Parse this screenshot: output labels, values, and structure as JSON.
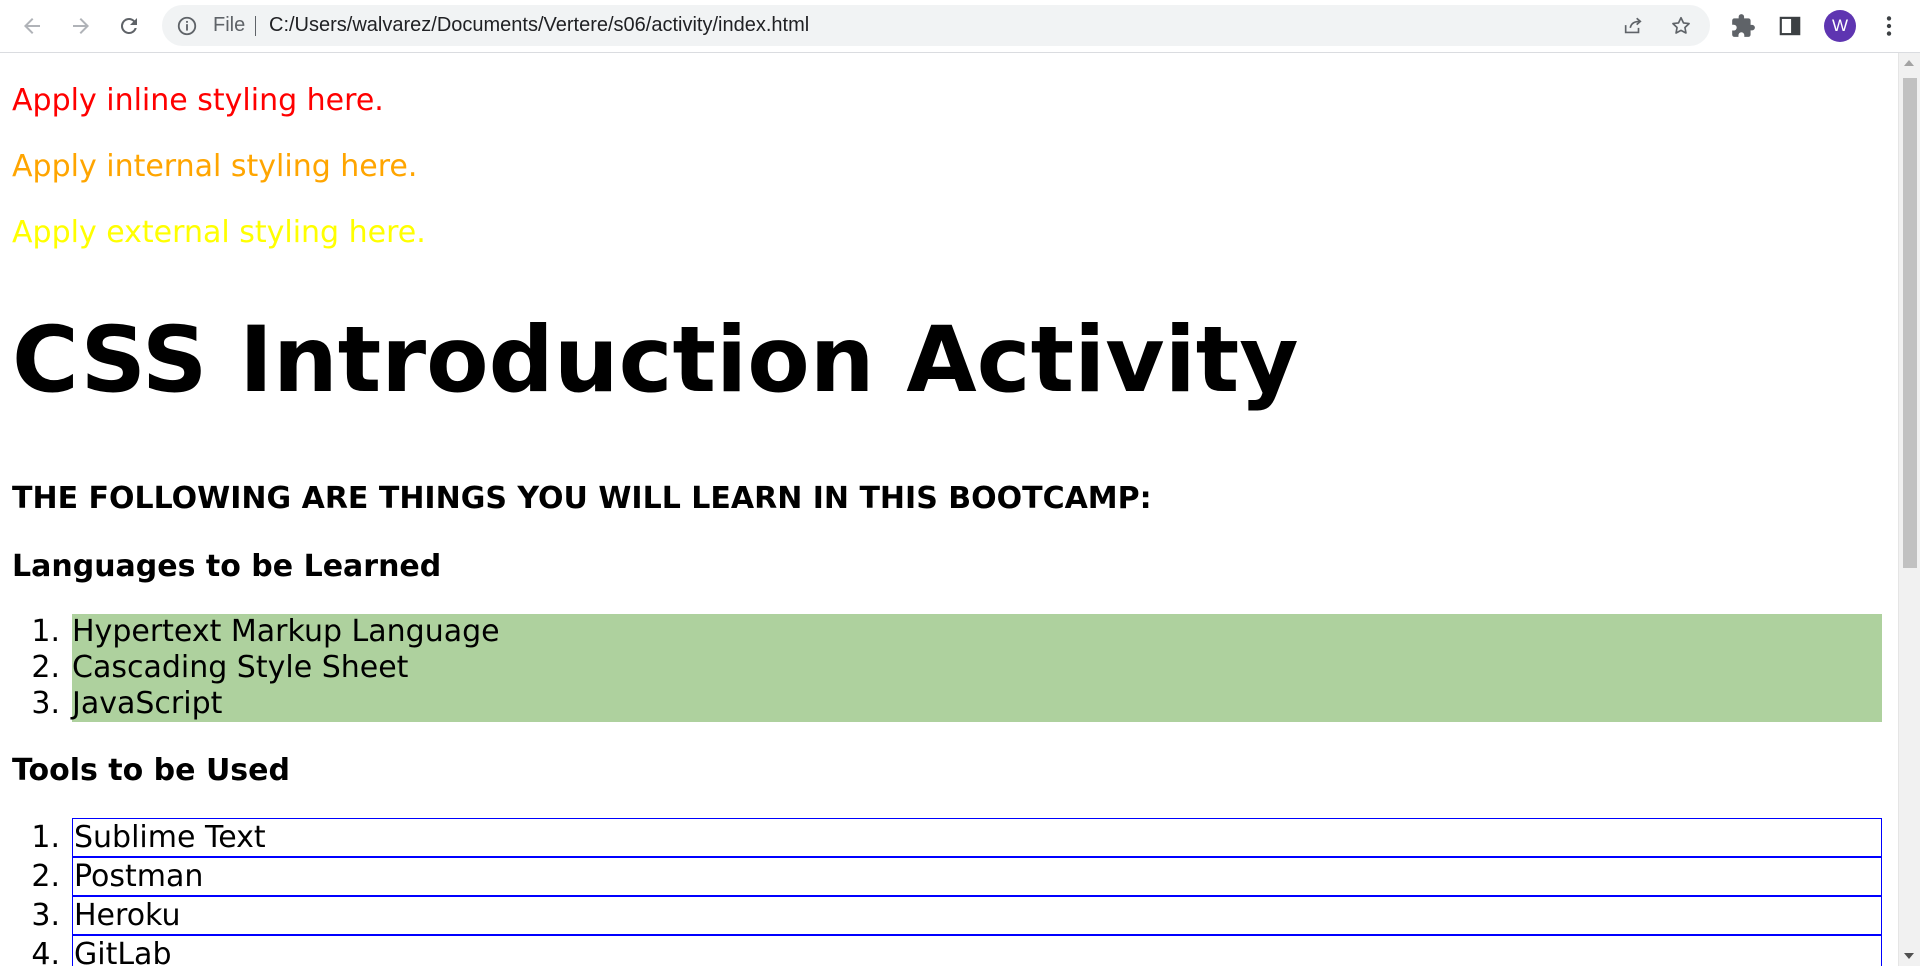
{
  "browser": {
    "omnibox": {
      "scheme_label": "File",
      "url": "C:/Users/walvarez/Documents/Vertere/s06/activity/index.html"
    },
    "profile_initial": "W"
  },
  "content": {
    "inline_text": "Apply inline styling here.",
    "internal_text": "Apply internal styling here.",
    "external_text": "Apply external styling here.",
    "title": "CSS Introduction Activity",
    "subtitle": "THE FOLLOWING ARE THINGS YOU WILL LEARN IN THIS BOOTCAMP:",
    "languages": {
      "heading": "Languages to be Learned",
      "items": [
        {
          "num": "1.",
          "label": "Hypertext Markup Language"
        },
        {
          "num": "2.",
          "label": "Cascading Style Sheet"
        },
        {
          "num": "3.",
          "label": "JavaScript"
        }
      ]
    },
    "tools": {
      "heading": "Tools to be Used",
      "items": [
        {
          "num": "1.",
          "label": "Sublime Text"
        },
        {
          "num": "2.",
          "label": "Postman"
        },
        {
          "num": "3.",
          "label": "Heroku"
        },
        {
          "num": "4.",
          "label": "GitLab"
        }
      ]
    }
  },
  "colors": {
    "inline": "#ff0000",
    "internal": "#ffa500",
    "external": "#ffff00",
    "languages_bg": "#aed19e",
    "tools_border": "#0000ff",
    "avatar": "#5e35b1"
  },
  "icons": [
    "back-arrow-icon",
    "forward-arrow-icon",
    "reload-icon",
    "info-icon",
    "share-icon",
    "star-icon",
    "extensions-icon",
    "side-panel-icon",
    "kebab-menu-icon"
  ]
}
